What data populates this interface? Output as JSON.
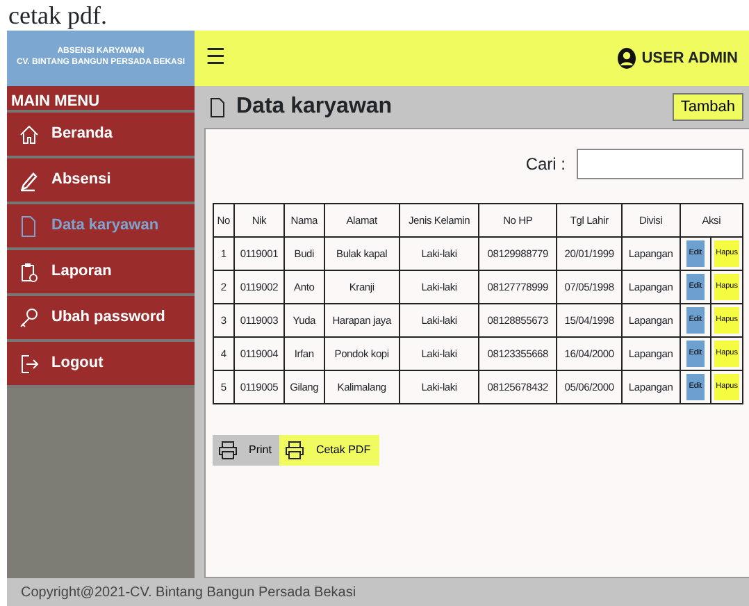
{
  "document_caption": "cetak pdf.",
  "brand": {
    "line1": "ABSENSI KARYAWAN",
    "line2": "CV. BINTANG BANGUN PERSADA BEKASI"
  },
  "header": {
    "menu_glyph": "☰",
    "user": "USER ADMIN"
  },
  "sidebar": {
    "title": "MAIN MENU",
    "items": [
      {
        "label": "Beranda",
        "kind": "home",
        "selected": false
      },
      {
        "label": "Absensi",
        "kind": "pencil",
        "selected": false
      },
      {
        "label": "Data karyawan",
        "kind": "file",
        "selected": true
      },
      {
        "label": "Laporan",
        "kind": "clipboard",
        "selected": false
      },
      {
        "label": "Ubah password",
        "kind": "key",
        "selected": false
      },
      {
        "label": "Logout",
        "kind": "logout",
        "selected": false
      }
    ]
  },
  "page": {
    "title": "Data karyawan",
    "add_button": "Tambah",
    "search_label": "Cari :"
  },
  "table": {
    "columns": [
      "No",
      "Nik",
      "Nama",
      "Alamat",
      "Jenis Kelamin",
      "No HP",
      "Tgl Lahir",
      "Divisi",
      "Aksi"
    ],
    "rows": [
      {
        "cells": [
          "1",
          "0119001",
          "Budi",
          "Bulak kapal",
          "Laki-laki",
          "08129988779",
          "20/01/1999",
          "Lapangan"
        ],
        "edit": "Edit",
        "delete": "Hapus"
      },
      {
        "cells": [
          "2",
          "0119002",
          "Anto",
          "Kranji",
          "Laki-laki",
          "08127778999",
          "07/05/1998",
          "Lapangan"
        ],
        "edit": "Edit",
        "delete": "Hapus"
      },
      {
        "cells": [
          "3",
          "0119003",
          "Yuda",
          "Harapan jaya",
          "Laki-laki",
          "08128855673",
          "15/04/1998",
          "Lapangan"
        ],
        "edit": "Edit",
        "delete": "Hapus"
      },
      {
        "cells": [
          "4",
          "0119004",
          "Irfan",
          "Pondok kopi",
          "Laki-laki",
          "08123355668",
          "16/04/2000",
          "Lapangan"
        ],
        "edit": "Edit",
        "delete": "Hapus"
      },
      {
        "cells": [
          "5",
          "0119005",
          "Gilang",
          "Kalimalang",
          "Laki-laki",
          "08125678432",
          "05/06/2000",
          "Lapangan"
        ],
        "edit": "Edit",
        "delete": "Hapus"
      }
    ]
  },
  "export_buttons": [
    {
      "label": "Print",
      "kind": "print"
    },
    {
      "label": "Cetak PDF",
      "kind": "pdf"
    }
  ],
  "footer": "Copyright@2021-CV. Bintang Bangun Persada Bekasi"
}
